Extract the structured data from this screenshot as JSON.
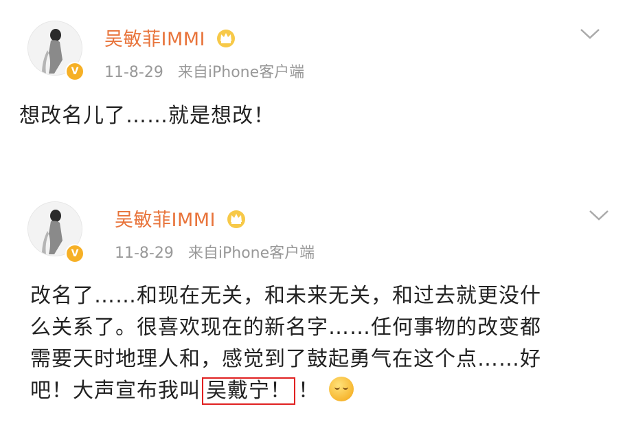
{
  "posts": [
    {
      "username": "吴敏菲IMMI",
      "date": "11-8-29",
      "source": "来自iPhone客户端",
      "lines": [
        "想改名儿了……就是想改！"
      ]
    },
    {
      "username": "吴敏菲IMMI",
      "date": "11-8-29",
      "source": "来自iPhone客户端",
      "lines": [
        "改名了……和现在无关，和未来无关，和过去就更没什",
        "么关系了。很喜欢现在的新名字……任何事物的改变都",
        "需要天时地理人和，感觉到了鼓起勇气在这个点……好"
      ],
      "last_line_prefix": "吧！大声宣布我叫",
      "highlighted_name": "吴戴宁！",
      "last_line_suffix": "！"
    }
  ],
  "icons": {
    "verified": "verified-badge-icon",
    "crown": "vip-crown-icon",
    "chevron": "chevron-down-icon",
    "emoji": "blushing-face-emoji"
  },
  "colors": {
    "username": "#e8743b",
    "meta": "#999999",
    "highlight_border": "#e02020",
    "badge": "#f6b026"
  }
}
